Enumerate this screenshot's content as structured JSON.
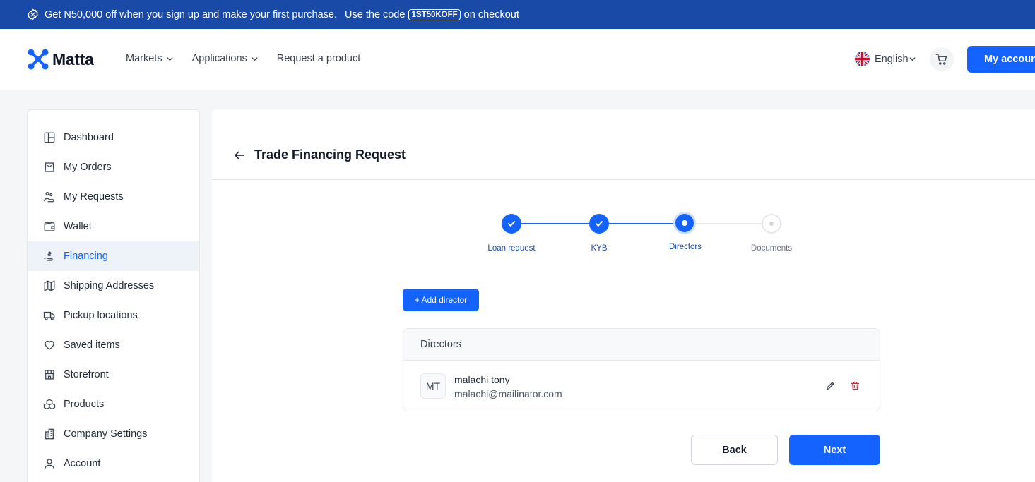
{
  "promo": {
    "text_before": "Get N50,000 off when you sign up and make your first purchase.",
    "text_code_prefix": "Use the code",
    "code": "1ST50KOFF",
    "text_after": "on checkout"
  },
  "header": {
    "logo_text": "Matta",
    "nav": [
      {
        "label": "Markets",
        "has_dropdown": true
      },
      {
        "label": "Applications",
        "has_dropdown": true
      },
      {
        "label": "Request a product",
        "has_dropdown": false
      }
    ],
    "language": "English",
    "account_label": "My account"
  },
  "sidebar": {
    "items": [
      {
        "label": "Dashboard",
        "icon": "layout-icon"
      },
      {
        "label": "My Orders",
        "icon": "bag-icon"
      },
      {
        "label": "My Requests",
        "icon": "requests-icon"
      },
      {
        "label": "Wallet",
        "icon": "wallet-icon"
      },
      {
        "label": "Financing",
        "icon": "financing-icon",
        "active": true
      },
      {
        "label": "Shipping Addresses",
        "icon": "map-icon"
      },
      {
        "label": "Pickup locations",
        "icon": "truck-icon"
      },
      {
        "label": "Saved items",
        "icon": "heart-icon"
      },
      {
        "label": "Storefront",
        "icon": "store-icon"
      },
      {
        "label": "Products",
        "icon": "boxes-icon"
      },
      {
        "label": "Company Settings",
        "icon": "building-icon"
      },
      {
        "label": "Account",
        "icon": "user-icon"
      }
    ]
  },
  "main": {
    "title": "Trade Financing Request",
    "steps": [
      {
        "label": "Loan request",
        "state": "done"
      },
      {
        "label": "KYB",
        "state": "done"
      },
      {
        "label": "Directors",
        "state": "current"
      },
      {
        "label": "Documents",
        "state": "pending"
      }
    ],
    "add_director_label": "+ Add director",
    "directors_header": "Directors",
    "directors": [
      {
        "initials": "MT",
        "name": "malachi tony",
        "email": "malachi@mailinator.com"
      }
    ],
    "back_label": "Back",
    "next_label": "Next"
  },
  "colors": {
    "primary": "#1463ff",
    "banner": "#1a4aa8",
    "danger": "#e11d2e"
  }
}
